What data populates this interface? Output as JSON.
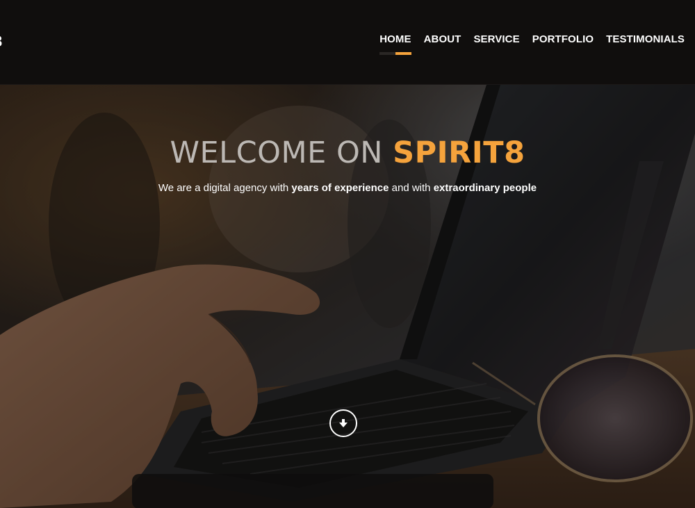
{
  "header": {
    "logo_fragment": "3",
    "nav": [
      {
        "label": "HOME",
        "active": true
      },
      {
        "label": "ABOUT",
        "active": false
      },
      {
        "label": "SERVICE",
        "active": false
      },
      {
        "label": "PORTFOLIO",
        "active": false
      },
      {
        "label": "TESTIMONIALS",
        "active": false
      }
    ]
  },
  "hero": {
    "title_light": "WELCOME ON ",
    "title_brand": "SPIRIT8",
    "subtitle": {
      "part1": "We are a digital agency with ",
      "bold1": "years of experience",
      "part2": " and with ",
      "bold2": "extraordinary people"
    },
    "scroll_icon": "arrow-down-circle-icon",
    "background_image": "laptop-typing-photo"
  },
  "colors": {
    "accent": "#f5a33c",
    "header_bg": "#100e0d",
    "text_light": "#ffffff",
    "title_gray": "#bcb8b4"
  }
}
